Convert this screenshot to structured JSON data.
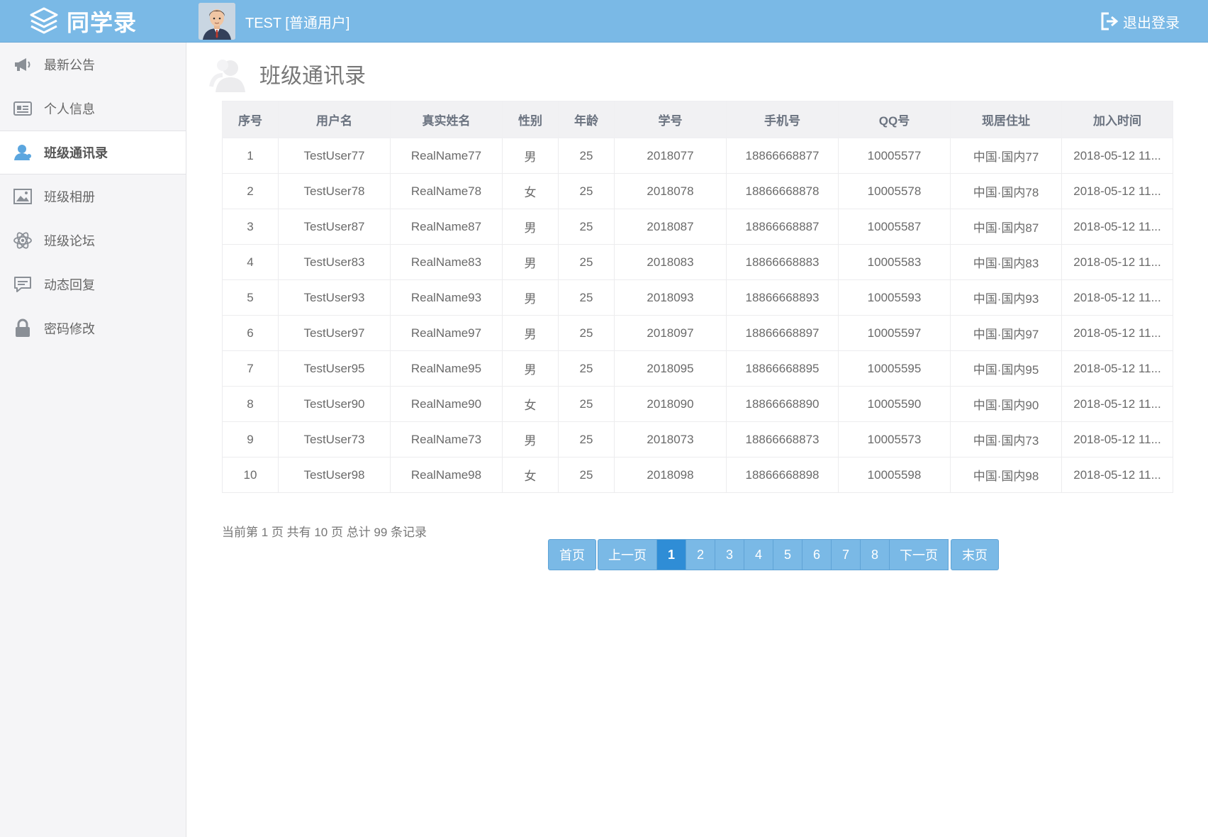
{
  "header": {
    "app_name": "同学录",
    "user_label": "TEST [普通用户]",
    "logout_label": "退出登录"
  },
  "sidebar": {
    "items": [
      {
        "label": "最新公告",
        "icon": "megaphone-icon"
      },
      {
        "label": "个人信息",
        "icon": "id-card-icon"
      },
      {
        "label": "班级通讯录",
        "icon": "user-icon",
        "active": true
      },
      {
        "label": "班级相册",
        "icon": "picture-icon"
      },
      {
        "label": "班级论坛",
        "icon": "atom-icon"
      },
      {
        "label": "动态回复",
        "icon": "comment-icon"
      },
      {
        "label": "密码修改",
        "icon": "lock-icon"
      }
    ]
  },
  "main": {
    "title": "班级通讯录",
    "table": {
      "columns": [
        "序号",
        "用户名",
        "真实姓名",
        "性别",
        "年龄",
        "学号",
        "手机号",
        "QQ号",
        "现居住址",
        "加入时间"
      ],
      "rows": [
        [
          "1",
          "TestUser77",
          "RealName77",
          "男",
          "25",
          "2018077",
          "18866668877",
          "10005577",
          "中国·国内77",
          "2018-05-12 11..."
        ],
        [
          "2",
          "TestUser78",
          "RealName78",
          "女",
          "25",
          "2018078",
          "18866668878",
          "10005578",
          "中国·国内78",
          "2018-05-12 11..."
        ],
        [
          "3",
          "TestUser87",
          "RealName87",
          "男",
          "25",
          "2018087",
          "18866668887",
          "10005587",
          "中国·国内87",
          "2018-05-12 11..."
        ],
        [
          "4",
          "TestUser83",
          "RealName83",
          "男",
          "25",
          "2018083",
          "18866668883",
          "10005583",
          "中国·国内83",
          "2018-05-12 11..."
        ],
        [
          "5",
          "TestUser93",
          "RealName93",
          "男",
          "25",
          "2018093",
          "18866668893",
          "10005593",
          "中国·国内93",
          "2018-05-12 11..."
        ],
        [
          "6",
          "TestUser97",
          "RealName97",
          "男",
          "25",
          "2018097",
          "18866668897",
          "10005597",
          "中国·国内97",
          "2018-05-12 11..."
        ],
        [
          "7",
          "TestUser95",
          "RealName95",
          "男",
          "25",
          "2018095",
          "18866668895",
          "10005595",
          "中国·国内95",
          "2018-05-12 11..."
        ],
        [
          "8",
          "TestUser90",
          "RealName90",
          "女",
          "25",
          "2018090",
          "18866668890",
          "10005590",
          "中国·国内90",
          "2018-05-12 11..."
        ],
        [
          "9",
          "TestUser73",
          "RealName73",
          "男",
          "25",
          "2018073",
          "18866668873",
          "10005573",
          "中国·国内73",
          "2018-05-12 11..."
        ],
        [
          "10",
          "TestUser98",
          "RealName98",
          "女",
          "25",
          "2018098",
          "18866668898",
          "10005598",
          "中国·国内98",
          "2018-05-12 11..."
        ]
      ]
    },
    "summary": "当前第 1 页 共有 10 页 总计 99 条记录",
    "pagination": {
      "first_label": "首页",
      "prev_label": "上一页",
      "pages": [
        "1",
        "2",
        "3",
        "4",
        "5",
        "6",
        "7",
        "8"
      ],
      "current": "1",
      "next_label": "下一页",
      "last_label": "末页"
    }
  },
  "colors": {
    "header_bg": "#7ab9e6",
    "sidebar_bg": "#f5f5f7",
    "accent": "#2f8dd6"
  }
}
